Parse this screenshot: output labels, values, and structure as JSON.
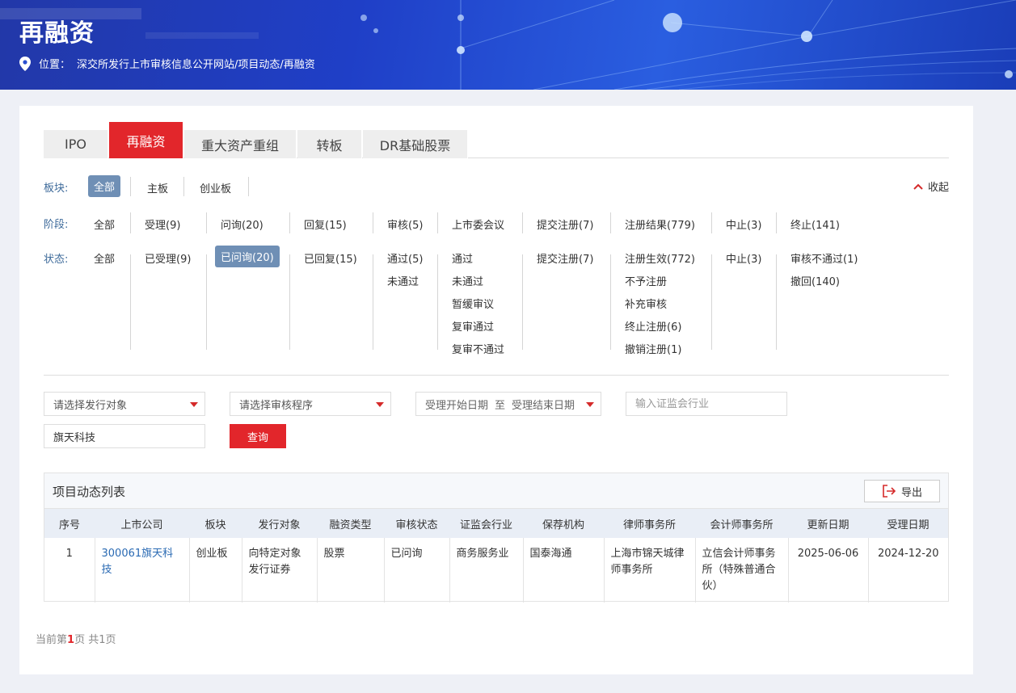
{
  "banner": {
    "title": "再融资",
    "location_label": "位置：",
    "location_path": "深交所发行上市审核信息公开网站/项目动态/再融资"
  },
  "tabs": [
    {
      "label": "IPO",
      "active": false
    },
    {
      "label": "再融资",
      "active": true
    },
    {
      "label": "重大资产重组",
      "active": false
    },
    {
      "label": "转板",
      "active": false
    },
    {
      "label": "DR基础股票",
      "active": false
    }
  ],
  "filters": {
    "board_label": "板块:",
    "board_options": [
      "全部",
      "主板",
      "创业板"
    ],
    "collapse_label": "收起",
    "stage_label": "阶段:",
    "stage_options": [
      "全部",
      "受理(9)",
      "问询(20)",
      "回复(15)",
      "审核(5)",
      "上市委会议",
      "提交注册(7)",
      "注册结果(779)",
      "中止(3)",
      "终止(141)"
    ],
    "status_label": "状态:",
    "status_columns": [
      [
        "全部"
      ],
      [
        "已受理(9)"
      ],
      [
        "已问询(20)"
      ],
      [
        "已回复(15)"
      ],
      [
        "通过(5)",
        "未通过"
      ],
      [
        "通过",
        "未通过",
        "暂缓审议",
        "复审通过",
        "复审不通过"
      ],
      [
        "提交注册(7)"
      ],
      [
        "注册生效(772)",
        "不予注册",
        "补充审核",
        "终止注册(6)",
        "撤销注册(1)"
      ],
      [
        "中止(3)"
      ],
      [
        "审核不通过(1)",
        "撤回(140)"
      ]
    ]
  },
  "search": {
    "issue_target_placeholder": "请选择发行对象",
    "review_procedure_placeholder": "请选择审核程序",
    "date_start": "受理开始日期",
    "date_to": "至",
    "date_end": "受理结束日期",
    "industry_placeholder": "输入证监会行业",
    "keyword_value": "旗天科技",
    "query_label": "查询"
  },
  "list": {
    "title": "项目动态列表",
    "export_label": "导出",
    "columns": [
      "序号",
      "上市公司",
      "板块",
      "发行对象",
      "融资类型",
      "审核状态",
      "证监会行业",
      "保荐机构",
      "律师事务所",
      "会计师事务所",
      "更新日期",
      "受理日期"
    ],
    "rows": [
      {
        "no": "1",
        "company": "300061旗天科技",
        "board": "创业板",
        "target": "向特定对象发行证券",
        "finance_type": "股票",
        "status": "已问询",
        "industry": "商务服务业",
        "sponsor": "国泰海通",
        "law_firm": "上海市锦天城律师事务所",
        "accounting_firm": "立信会计师事务所（特殊普通合伙）",
        "update_date": "2025-06-06",
        "accept_date": "2024-12-20"
      }
    ]
  },
  "pager": {
    "prefix": "当前第",
    "page": "1",
    "mid": "页 共",
    "total": "1",
    "suffix": "页"
  }
}
